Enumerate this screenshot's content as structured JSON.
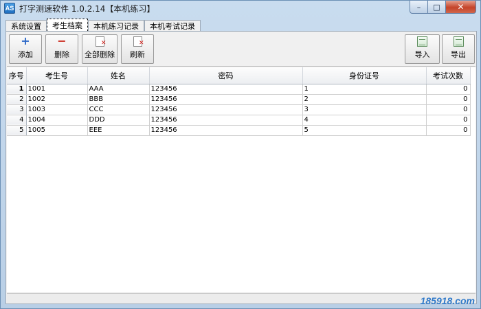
{
  "window": {
    "title": "打字测速软件  1.0.2.14【本机练习】",
    "app_icon": "AS",
    "controls": {
      "minimize": "–",
      "maximize": "□",
      "close": "✕"
    }
  },
  "tabs": [
    {
      "label": "系统设置",
      "active": false
    },
    {
      "label": "考生档案",
      "active": true
    },
    {
      "label": "本机练习记录",
      "active": false
    },
    {
      "label": "本机考试记录",
      "active": false
    }
  ],
  "toolbar": {
    "add_label": "添加",
    "delete_label": "删除",
    "delete_all_label": "全部删除",
    "refresh_label": "刷新",
    "import_label": "导入",
    "export_label": "导出",
    "icons": {
      "add": "+",
      "delete": "−",
      "delete_all": "document-delete-icon",
      "refresh": "document-refresh-icon",
      "import": "excel-import-icon",
      "export": "excel-export-icon"
    }
  },
  "grid": {
    "columns": [
      "序号",
      "考生号",
      "姓名",
      "密码",
      "身份证号",
      "考试次数"
    ],
    "rows": [
      {
        "seq": "1",
        "id": "1001",
        "name": "AAA",
        "password": "123456",
        "idcard": "1",
        "count": "0"
      },
      {
        "seq": "2",
        "id": "1002",
        "name": "BBB",
        "password": "123456",
        "idcard": "2",
        "count": "0"
      },
      {
        "seq": "3",
        "id": "1003",
        "name": "CCC",
        "password": "123456",
        "idcard": "3",
        "count": "0"
      },
      {
        "seq": "4",
        "id": "1004",
        "name": "DDD",
        "password": "123456",
        "idcard": "4",
        "count": "0"
      },
      {
        "seq": "5",
        "id": "1005",
        "name": "EEE",
        "password": "123456",
        "idcard": "5",
        "count": "0"
      }
    ]
  },
  "watermark": "185918.com",
  "colors": {
    "close_button": "#c4442a",
    "add_icon": "#2b67c7",
    "delete_icon": "#c9281b",
    "watermark": "#2f79c9"
  }
}
